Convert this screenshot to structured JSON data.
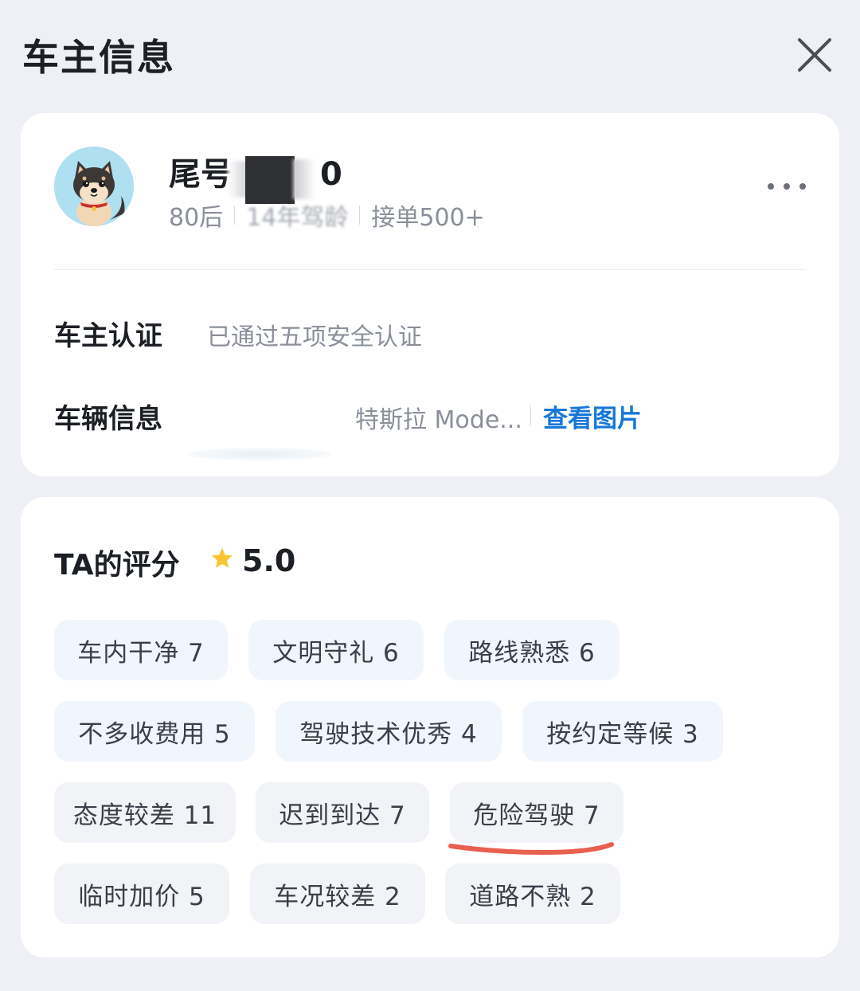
{
  "header": {
    "title": "车主信息",
    "close_icon": "close-icon"
  },
  "driver": {
    "name_prefix": "尾号",
    "name_suffix": "0",
    "age_group": "80后",
    "driving_years": "14年驾龄",
    "orders": "接单500+",
    "avatar_icon": "shiba-dog-avatar-icon"
  },
  "certification": {
    "label": "车主认证",
    "value": "已通过五项安全认证"
  },
  "vehicle": {
    "label": "车辆信息",
    "value": "特斯拉 Mode...",
    "link": "查看图片"
  },
  "rating": {
    "title": "TA的评分",
    "score": "5.0",
    "star_color": "#f7c531",
    "positive_tags": [
      {
        "label": "车内干净 7"
      },
      {
        "label": "文明守礼 6"
      },
      {
        "label": "路线熟悉 6"
      },
      {
        "label": "不多收费用 5"
      },
      {
        "label": "驾驶技术优秀 4"
      },
      {
        "label": "按约定等候 3"
      }
    ],
    "negative_tags": [
      {
        "label": "态度较差 11"
      },
      {
        "label": "迟到到达 7"
      },
      {
        "label": "危险驾驶 7"
      },
      {
        "label": "临时加价 5"
      },
      {
        "label": "车况较差 2"
      },
      {
        "label": "道路不熟 2"
      }
    ]
  },
  "colors": {
    "background": "#eef0f5",
    "card": "#ffffff",
    "link_blue": "#1677d8",
    "positive_tag_bg": "#f1f6fc",
    "negative_tag_bg": "#f2f3f6",
    "highlight_underline": "#e8604f"
  }
}
